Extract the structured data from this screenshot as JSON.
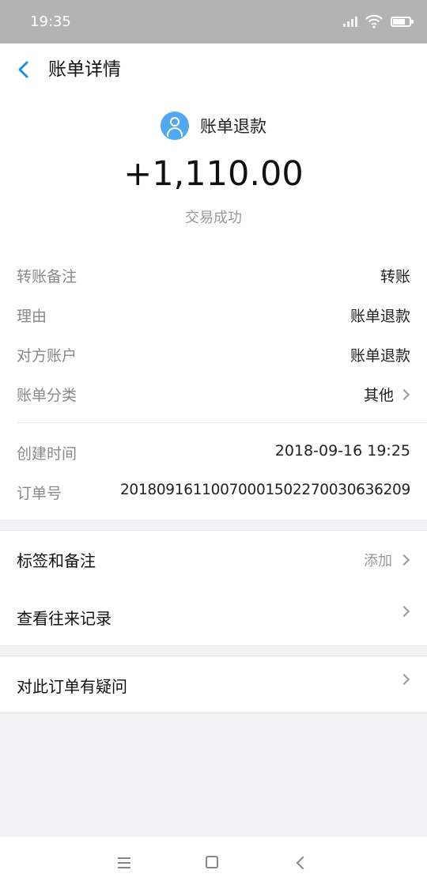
{
  "status_bar": {
    "time": "19:35",
    "icons": [
      "signal-icon",
      "wifi-icon",
      "battery-icon"
    ]
  },
  "header": {
    "title": "账单详情"
  },
  "summary": {
    "name": "账单退款",
    "amount": "+1,110.00",
    "status": "交易成功"
  },
  "details": {
    "remark_label": "转账备注",
    "remark_value": "转账",
    "reason_label": "理由",
    "reason_value": "账单退款",
    "counterparty_label": "对方账户",
    "counterparty_value": "账单退款",
    "category_label": "账单分类",
    "category_value": "其他",
    "created_label": "创建时间",
    "created_value": "2018-09-16 19:25",
    "order_label": "订单号",
    "order_value": "2018091611007000150227003063620 9"
  },
  "menu": {
    "tags_label": "标签和备注",
    "tags_action": "添加",
    "history_label": "查看往来记录",
    "question_label": "对此订单有疑问"
  },
  "colors": {
    "accent": "#1a8fe3",
    "avatar": "#4fa8f0",
    "status_bar": "#b3b3b3"
  }
}
